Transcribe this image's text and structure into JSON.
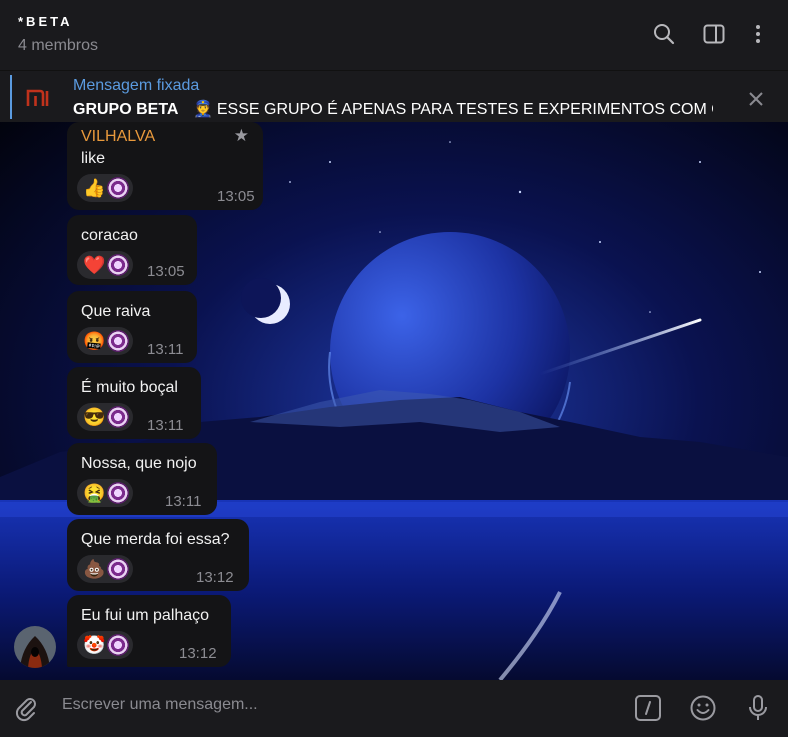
{
  "header": {
    "title": "*BETA",
    "subtitle": "4 membros"
  },
  "pinned": {
    "label": "Mensagem fixada",
    "group": "GRUPO BETA",
    "text": "ESSE GRUPO É APENAS PARA TESTES E EXPERIMENTOS COM OS B..."
  },
  "messages": [
    {
      "sender": "VILHALVA",
      "text": "like",
      "time": "13:05",
      "reaction": "👍"
    },
    {
      "text": "coracao",
      "time": "13:05",
      "reaction": "❤️"
    },
    {
      "text": "Que raiva",
      "time": "13:11",
      "reaction": "🤬"
    },
    {
      "text": "É muito boçal",
      "time": "13:11",
      "reaction": "😎"
    },
    {
      "text": "Nossa, que nojo",
      "time": "13:11",
      "reaction": "🤮"
    },
    {
      "text": "Que merda foi essa?",
      "time": "13:12",
      "reaction": "💩"
    },
    {
      "text": "Eu fui um palhaço",
      "time": "13:12",
      "reaction": "🤡"
    }
  ],
  "composer": {
    "placeholder": "Escrever uma mensagem..."
  },
  "colors": {
    "accent": "#5b9be0",
    "sender": "#e8993c",
    "bubble": "#141416"
  },
  "icons": [
    "search-icon",
    "sidebar-toggle-icon",
    "more-vertical-icon",
    "close-icon",
    "attach-icon",
    "commands-icon",
    "emoji-icon",
    "microphone-icon",
    "star-icon"
  ]
}
